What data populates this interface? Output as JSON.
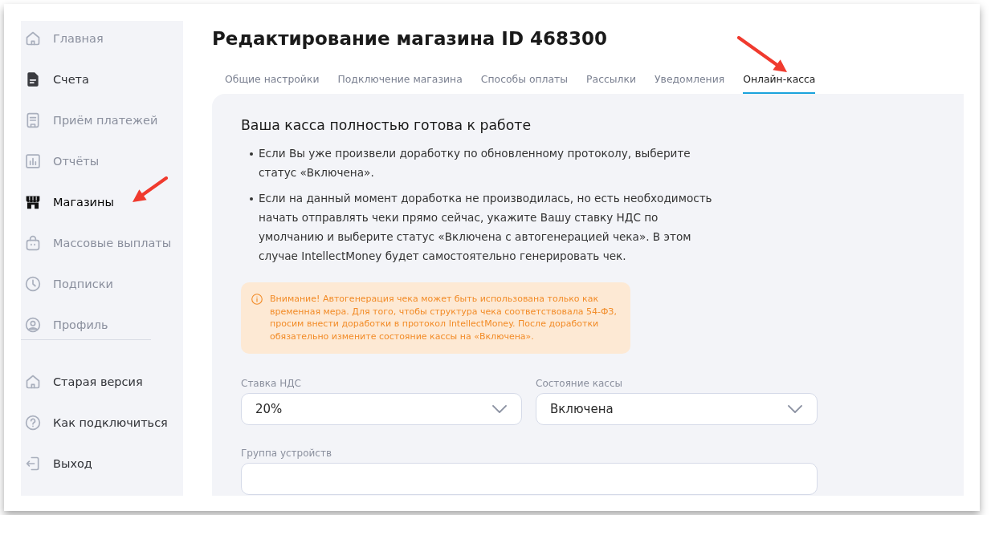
{
  "sidebar": {
    "items": [
      {
        "label": "Главная",
        "selected": false,
        "disabled": true,
        "highlighted": false
      },
      {
        "label": "Счета",
        "selected": false,
        "disabled": false,
        "highlighted": true
      },
      {
        "label": "Приём платежей",
        "selected": false,
        "disabled": true,
        "highlighted": false
      },
      {
        "label": "Отчёты",
        "selected": false,
        "disabled": true,
        "highlighted": false
      },
      {
        "label": "Магазины",
        "selected": true,
        "disabled": false,
        "highlighted": false
      },
      {
        "label": "Массовые выплаты",
        "selected": false,
        "disabled": true,
        "highlighted": false
      },
      {
        "label": "Подписки",
        "selected": false,
        "disabled": true,
        "highlighted": false
      },
      {
        "label": "Профиль",
        "selected": false,
        "disabled": true,
        "highlighted": false
      }
    ],
    "footer_items": [
      {
        "label": "Старая версия",
        "selected": false,
        "disabled": false,
        "highlighted": false
      },
      {
        "label": "Как подключиться",
        "selected": false,
        "disabled": false,
        "highlighted": false
      },
      {
        "label": "Выход",
        "selected": false,
        "disabled": false,
        "highlighted": false
      }
    ]
  },
  "page": {
    "title": "Редактирование магазина ID 468300"
  },
  "tabs": [
    {
      "label": "Общие настройки",
      "selected": false
    },
    {
      "label": "Подключение магазина",
      "selected": false
    },
    {
      "label": "Способы оплаты",
      "selected": false
    },
    {
      "label": "Рассылки",
      "selected": false
    },
    {
      "label": "Уведомления",
      "selected": false
    },
    {
      "label": "Онлайн-касса",
      "selected": true
    }
  ],
  "panel": {
    "heading": "Ваша касса полностью готова к работе",
    "bullets": [
      "Если Вы уже произвели доработку по обновленному протоколу, выберите статус «Включена».",
      "Если на данный момент доработка не производилась, но есть необходимость начать отправлять чеки прямо сейчас, укажите Вашу ставку НДС по умолчанию и выберите статус «Включена с автогенерацией чека». В этом случае IntellectMoney будет самостоятельно генерировать чек."
    ],
    "warning": {
      "text": "Внимание! Автогенерация чека может быть использована только как временная мера. Для того, чтобы структура чека соответствовала 54-ФЗ, просим внести доработки в протокол IntellectMoney. После доработки обязательно измените состояние кассы на «Включена»."
    },
    "fields": [
      {
        "kind": "select",
        "label": "Ставка НДС",
        "value": "20%"
      },
      {
        "kind": "select",
        "label": "Состояние кассы",
        "value": "Включена"
      },
      {
        "kind": "input",
        "label": "Группа устройств"
      }
    ]
  }
}
